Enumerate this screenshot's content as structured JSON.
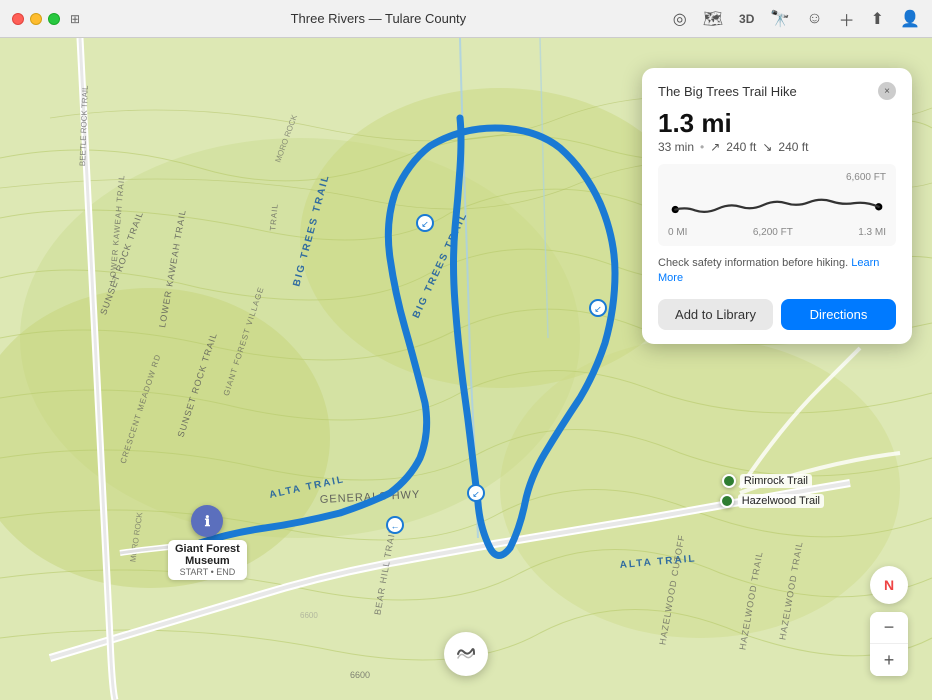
{
  "titlebar": {
    "title": "Three Rivers — Tulare County",
    "traffic_lights": [
      "red",
      "yellow",
      "green"
    ]
  },
  "toolbar": {
    "icons": [
      "location",
      "map",
      "3d",
      "binoculars",
      "face",
      "plus",
      "share",
      "person"
    ]
  },
  "trail_card": {
    "title": "The Big Trees Trail Hike",
    "distance": "1.3 mi",
    "time": "33 min",
    "elevation_up": "240 ft",
    "elevation_down": "240 ft",
    "elevation_high": "6,600 FT",
    "elevation_low": "6,200 FT",
    "chart_start_label": "0 MI",
    "chart_end_label": "1.3 MI",
    "safety_text": "Check safety information before hiking.",
    "learn_more_label": "Learn More",
    "add_to_library_label": "Add to Library",
    "directions_label": "Directions",
    "close_label": "×"
  },
  "museum_marker": {
    "label": "Giant Forest\nMuseum",
    "sublabel": "START • END",
    "icon": "ℹ"
  },
  "trail_markers": [
    {
      "name": "Rimrock Trail",
      "color": "#2e7d32"
    },
    {
      "name": "Hazelwood Trail",
      "color": "#2e7d32"
    }
  ],
  "map_controls": {
    "compass_label": "N",
    "zoom_in": "+",
    "zoom_out": "−"
  },
  "routing_icon": "〜"
}
